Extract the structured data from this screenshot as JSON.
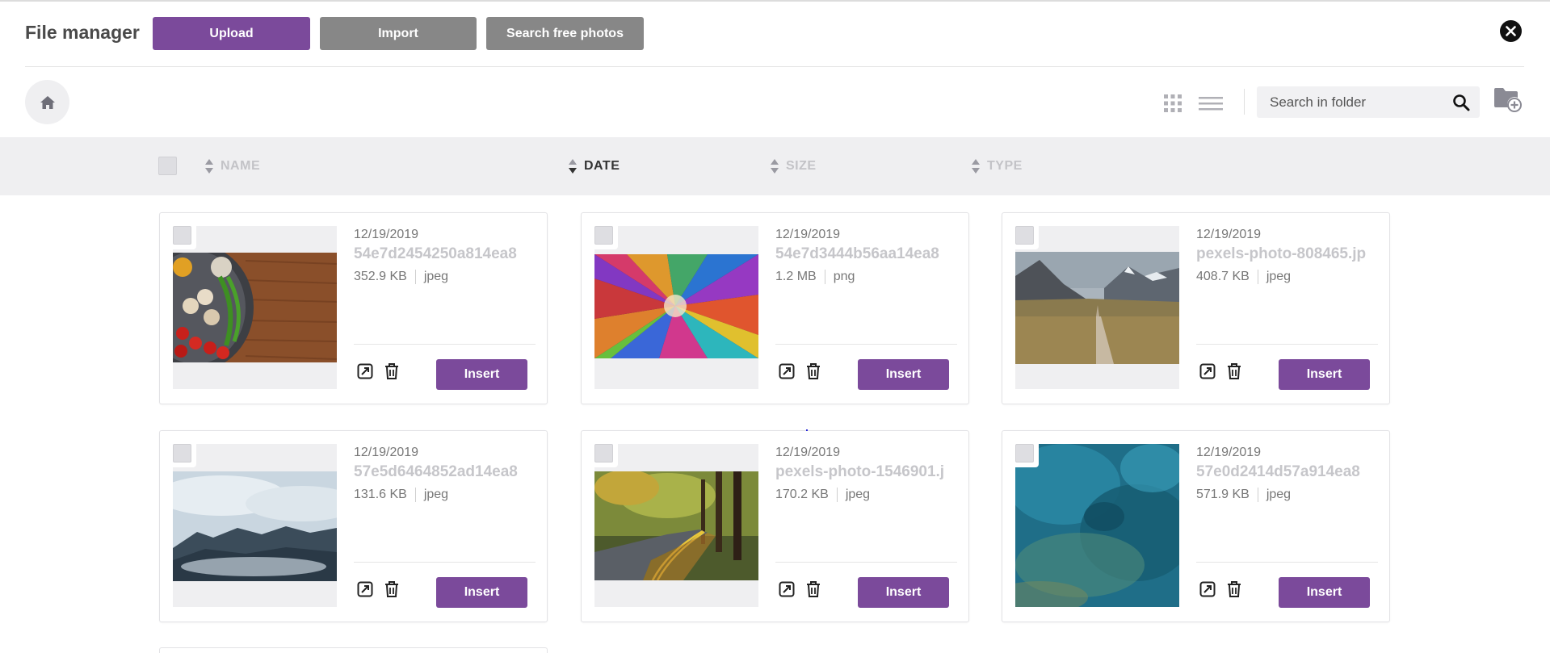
{
  "header": {
    "title": "File manager",
    "upload_label": "Upload",
    "import_label": "Import",
    "free_photos_label": "Search free photos",
    "close_icon": "close-icon"
  },
  "toolbar": {
    "home_icon": "home-icon",
    "grid_view_icon": "grid-view-icon",
    "list_view_icon": "list-view-icon",
    "search": {
      "placeholder": "Search in folder",
      "value": ""
    },
    "new_folder_icon": "folder-add-icon"
  },
  "columns": {
    "name": "NAME",
    "date": "DATE",
    "size": "SIZE",
    "type": "TYPE",
    "active": "date"
  },
  "files": [
    {
      "date": "12/19/2019",
      "name": "54e7d2454250a814ea8",
      "size": "352.9 KB",
      "type": "jpeg",
      "thumb": "vegetables",
      "insert_label": "Insert"
    },
    {
      "date": "12/19/2019",
      "name": "54e7d3444b56aa14ea8",
      "size": "1.2 MB",
      "type": "png",
      "thumb": "colorful-abstract",
      "insert_label": "Insert"
    },
    {
      "date": "12/19/2019",
      "name": "pexels-photo-808465.jp",
      "size": "408.7 KB",
      "type": "jpeg",
      "thumb": "mountain-path",
      "insert_label": "Insert"
    },
    {
      "date": "12/19/2019",
      "name": "57e5d6464852ad14ea8",
      "size": "131.6 KB",
      "type": "jpeg",
      "thumb": "foggy-forest",
      "insert_label": "Insert"
    },
    {
      "date": "12/19/2019",
      "name": "pexels-photo-1546901.j",
      "size": "170.2 KB",
      "type": "jpeg",
      "thumb": "forest-road",
      "insert_label": "Insert"
    },
    {
      "date": "12/19/2019",
      "name": "57e0d2414d57a914ea8",
      "size": "571.9 KB",
      "type": "jpeg",
      "thumb": "blue-texture",
      "insert_label": "Insert"
    }
  ],
  "colors": {
    "accent": "#7b4a9b",
    "secondary_button": "#878787",
    "panel_bg": "#efeff1"
  }
}
